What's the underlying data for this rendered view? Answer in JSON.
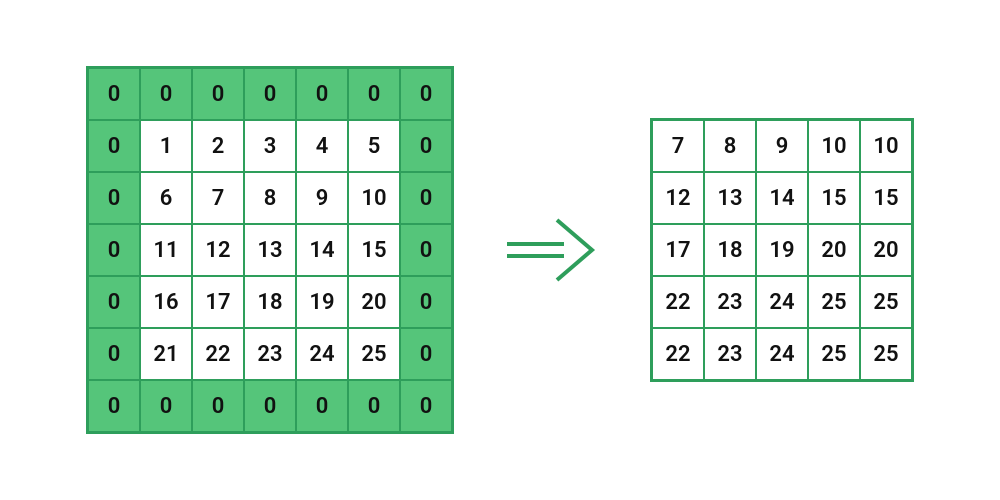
{
  "diagram": {
    "description": "Padded input matrix transformed to output matrix",
    "input_grid": {
      "rows": 7,
      "cols": 7,
      "cells": [
        {
          "v": "0",
          "pad": true
        },
        {
          "v": "0",
          "pad": true
        },
        {
          "v": "0",
          "pad": true
        },
        {
          "v": "0",
          "pad": true
        },
        {
          "v": "0",
          "pad": true
        },
        {
          "v": "0",
          "pad": true
        },
        {
          "v": "0",
          "pad": true
        },
        {
          "v": "0",
          "pad": true
        },
        {
          "v": "1",
          "pad": false
        },
        {
          "v": "2",
          "pad": false
        },
        {
          "v": "3",
          "pad": false
        },
        {
          "v": "4",
          "pad": false
        },
        {
          "v": "5",
          "pad": false
        },
        {
          "v": "0",
          "pad": true
        },
        {
          "v": "0",
          "pad": true
        },
        {
          "v": "6",
          "pad": false
        },
        {
          "v": "7",
          "pad": false
        },
        {
          "v": "8",
          "pad": false
        },
        {
          "v": "9",
          "pad": false
        },
        {
          "v": "10",
          "pad": false
        },
        {
          "v": "0",
          "pad": true
        },
        {
          "v": "0",
          "pad": true
        },
        {
          "v": "11",
          "pad": false
        },
        {
          "v": "12",
          "pad": false
        },
        {
          "v": "13",
          "pad": false
        },
        {
          "v": "14",
          "pad": false
        },
        {
          "v": "15",
          "pad": false
        },
        {
          "v": "0",
          "pad": true
        },
        {
          "v": "0",
          "pad": true
        },
        {
          "v": "16",
          "pad": false
        },
        {
          "v": "17",
          "pad": false
        },
        {
          "v": "18",
          "pad": false
        },
        {
          "v": "19",
          "pad": false
        },
        {
          "v": "20",
          "pad": false
        },
        {
          "v": "0",
          "pad": true
        },
        {
          "v": "0",
          "pad": true
        },
        {
          "v": "21",
          "pad": false
        },
        {
          "v": "22",
          "pad": false
        },
        {
          "v": "23",
          "pad": false
        },
        {
          "v": "24",
          "pad": false
        },
        {
          "v": "25",
          "pad": false
        },
        {
          "v": "0",
          "pad": true
        },
        {
          "v": "0",
          "pad": true
        },
        {
          "v": "0",
          "pad": true
        },
        {
          "v": "0",
          "pad": true
        },
        {
          "v": "0",
          "pad": true
        },
        {
          "v": "0",
          "pad": true
        },
        {
          "v": "0",
          "pad": true
        },
        {
          "v": "0",
          "pad": true
        }
      ]
    },
    "output_grid": {
      "rows": 5,
      "cols": 5,
      "cells": [
        {
          "v": "7"
        },
        {
          "v": "8"
        },
        {
          "v": "9"
        },
        {
          "v": "10"
        },
        {
          "v": "10"
        },
        {
          "v": "12"
        },
        {
          "v": "13"
        },
        {
          "v": "14"
        },
        {
          "v": "15"
        },
        {
          "v": "15"
        },
        {
          "v": "17"
        },
        {
          "v": "18"
        },
        {
          "v": "19"
        },
        {
          "v": "20"
        },
        {
          "v": "20"
        },
        {
          "v": "22"
        },
        {
          "v": "23"
        },
        {
          "v": "24"
        },
        {
          "v": "25"
        },
        {
          "v": "25"
        },
        {
          "v": "22"
        },
        {
          "v": "23"
        },
        {
          "v": "24"
        },
        {
          "v": "25"
        },
        {
          "v": "25"
        }
      ]
    },
    "colors": {
      "border": "#2e9e5b",
      "padding_fill": "#55c57a",
      "arrow": "#2e9e5b"
    }
  }
}
